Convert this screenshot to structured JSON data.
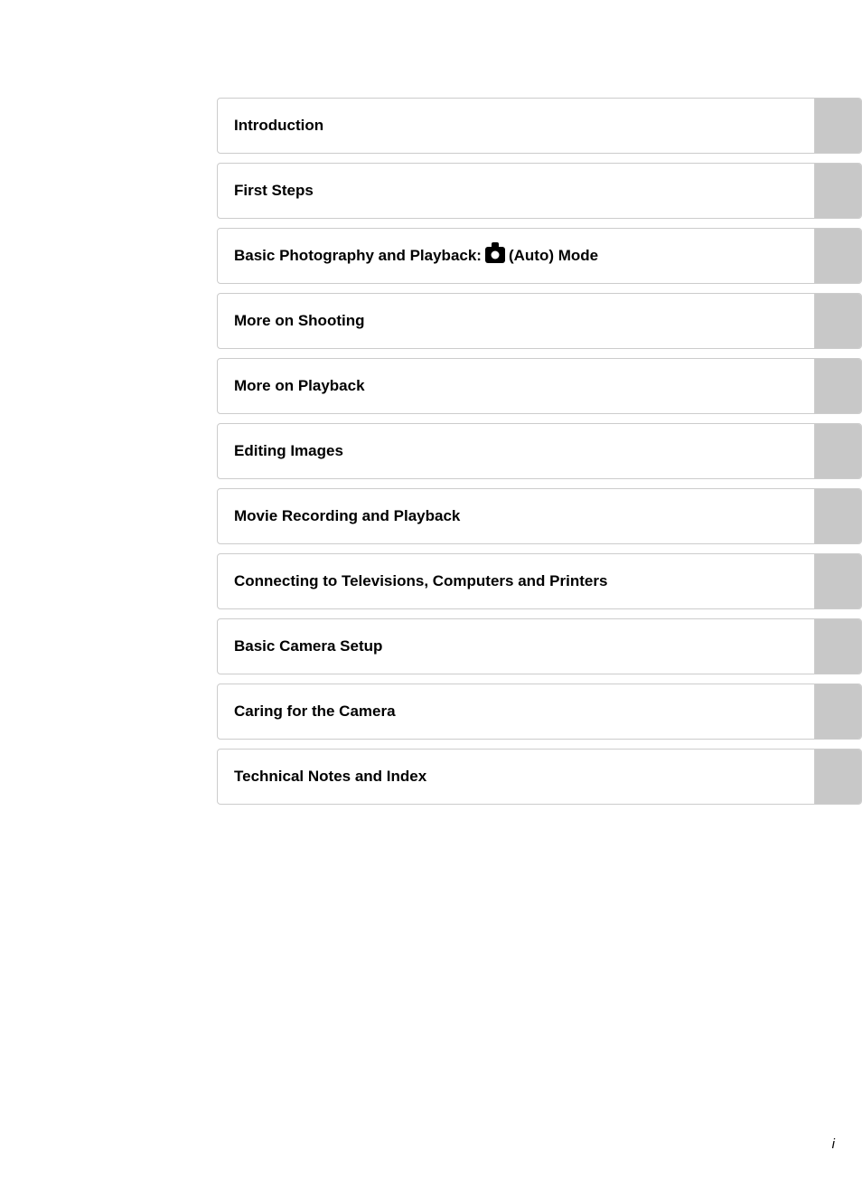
{
  "page": {
    "page_number": "i"
  },
  "toc": {
    "items": [
      {
        "id": "introduction",
        "label": "Introduction",
        "has_icon": false
      },
      {
        "id": "first-steps",
        "label": "First Steps",
        "has_icon": false
      },
      {
        "id": "basic-photography",
        "label": "Basic Photography and Playback:",
        "label_suffix": "(Auto) Mode",
        "has_icon": true
      },
      {
        "id": "more-on-shooting",
        "label": "More on Shooting",
        "has_icon": false
      },
      {
        "id": "more-on-playback",
        "label": "More on Playback",
        "has_icon": false
      },
      {
        "id": "editing-images",
        "label": "Editing Images",
        "has_icon": false
      },
      {
        "id": "movie-recording",
        "label": "Movie Recording and Playback",
        "has_icon": false
      },
      {
        "id": "connecting",
        "label": "Connecting to Televisions, Computers and Printers",
        "has_icon": false
      },
      {
        "id": "basic-camera-setup",
        "label": "Basic Camera Setup",
        "has_icon": false
      },
      {
        "id": "caring-for-camera",
        "label": "Caring for the Camera",
        "has_icon": false
      },
      {
        "id": "technical-notes",
        "label": "Technical Notes and Index",
        "has_icon": false
      }
    ]
  }
}
